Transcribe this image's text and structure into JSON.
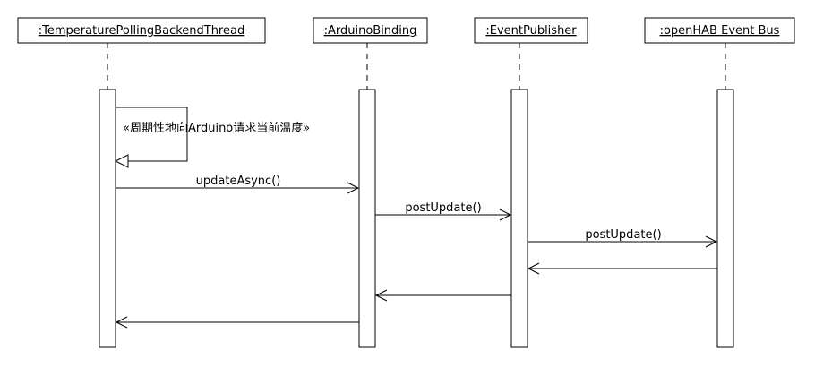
{
  "lifelines": [
    {
      "id": "poller",
      "label": ":TemperaturePollingBackendThread"
    },
    {
      "id": "arduino",
      "label": ":ArduinoBinding"
    },
    {
      "id": "publisher",
      "label": ":EventPublisher"
    },
    {
      "id": "bus",
      "label": ":openHAB Event Bus"
    }
  ],
  "messages": [
    {
      "from": "poller",
      "to": "poller",
      "kind": "self",
      "label": "«周期性地向Arduino请求当前温度»"
    },
    {
      "from": "poller",
      "to": "arduino",
      "kind": "call",
      "label": "updateAsync()"
    },
    {
      "from": "arduino",
      "to": "publisher",
      "kind": "call",
      "label": "postUpdate()"
    },
    {
      "from": "publisher",
      "to": "bus",
      "kind": "call",
      "label": "postUpdate()"
    },
    {
      "from": "bus",
      "to": "publisher",
      "kind": "return",
      "label": ""
    },
    {
      "from": "publisher",
      "to": "arduino",
      "kind": "return",
      "label": ""
    },
    {
      "from": "arduino",
      "to": "poller",
      "kind": "return",
      "label": ""
    }
  ]
}
